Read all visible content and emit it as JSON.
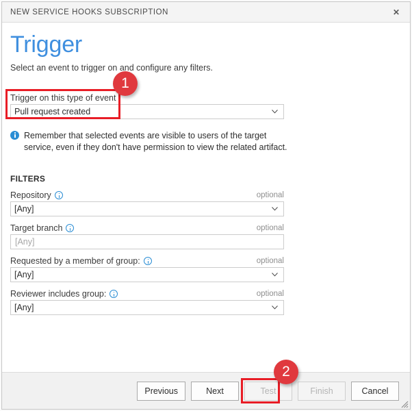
{
  "window": {
    "title": "NEW SERVICE HOOKS SUBSCRIPTION",
    "close_icon": "close-icon",
    "close_glyph": "✕",
    "resize_grip_icon": "resize-grip-icon"
  },
  "page": {
    "heading": "Trigger",
    "subheading": "Select an event to trigger on and configure any filters."
  },
  "trigger": {
    "label": "Trigger on this type of event",
    "value": "Pull request created",
    "chevron_icon": "chevron-down-icon"
  },
  "banner": {
    "icon": "info-filled-icon",
    "text": "Remember that selected events are visible to users of the target service, even if they don't have permission to view the related artifact."
  },
  "filters": {
    "heading": "FILTERS",
    "optional_tag": "optional",
    "info_icon": "info-circle-icon",
    "rows": [
      {
        "label": "Repository",
        "has_info": true,
        "colon": false,
        "control": "select",
        "value": "[Any]",
        "optional": "optional"
      },
      {
        "label": "Target branch",
        "has_info": true,
        "colon": false,
        "control": "text",
        "value": "",
        "placeholder": "[Any]",
        "optional": "optional"
      },
      {
        "label": "Requested by a member of group:",
        "has_info": true,
        "colon": true,
        "control": "select",
        "value": "[Any]",
        "optional": "optional"
      },
      {
        "label": "Reviewer includes group:",
        "has_info": true,
        "colon": true,
        "control": "select",
        "value": "[Any]",
        "optional": "optional"
      }
    ]
  },
  "footer": {
    "buttons": [
      {
        "label": "Previous",
        "disabled": false
      },
      {
        "label": "Next",
        "disabled": false
      },
      {
        "label": "Test",
        "disabled": true
      },
      {
        "label": "Finish",
        "disabled": true
      },
      {
        "label": "Cancel",
        "disabled": false
      }
    ]
  },
  "annotations": {
    "accent_color": "#e0393e",
    "box_color": "#e81d26",
    "items": [
      {
        "badge": "1",
        "target": "trigger-event-field"
      },
      {
        "badge": "2",
        "target": "next-button"
      }
    ]
  }
}
